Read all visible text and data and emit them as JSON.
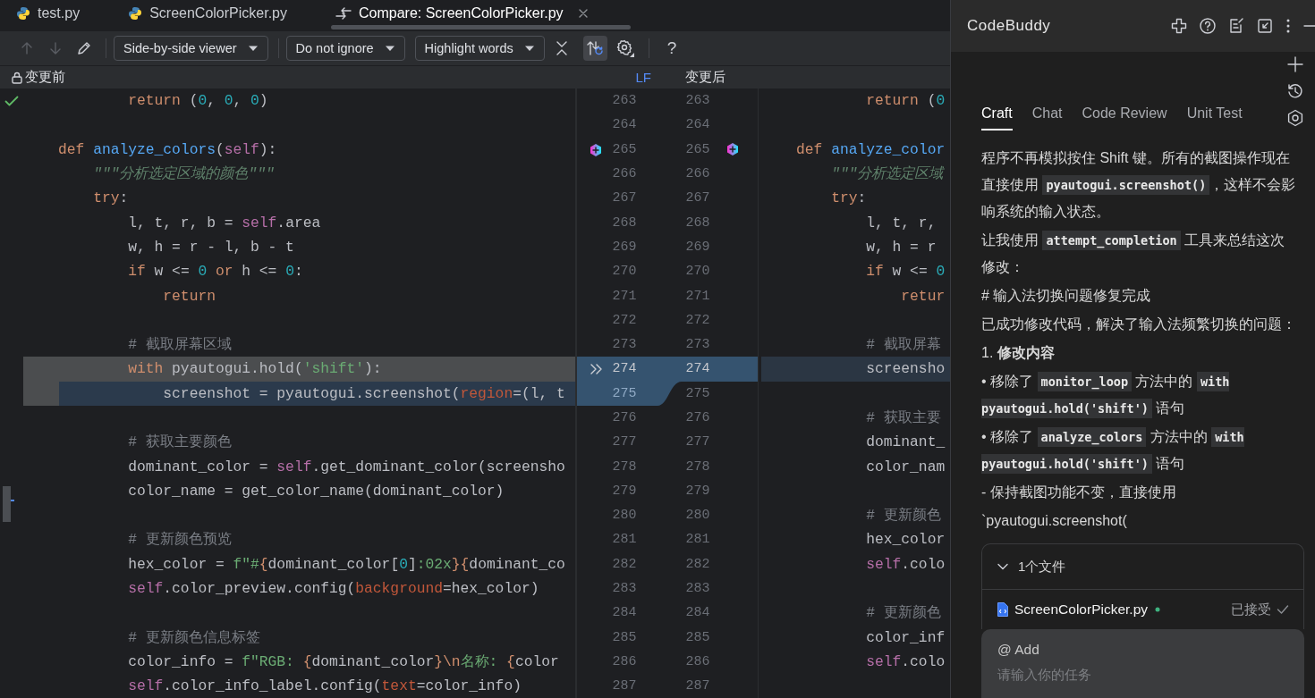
{
  "editor_tabs": [
    {
      "kind": "python",
      "label": "test.py",
      "selected": false
    },
    {
      "kind": "python",
      "label": "ScreenColorPicker.py",
      "selected": false
    },
    {
      "kind": "compare",
      "label": "Compare: ScreenColorPicker.py",
      "selected": true
    }
  ],
  "toolbar": [
    {
      "kind": "up",
      "disabled": true
    },
    {
      "kind": "down",
      "disabled": true
    },
    {
      "kind": "edit",
      "disabled": false
    },
    {
      "kind": "separator"
    },
    {
      "kind": "dropdown",
      "label": "Side-by-side viewer"
    },
    {
      "kind": "separator"
    },
    {
      "kind": "dropdown",
      "label": "Do not ignore"
    },
    {
      "kind": "dropdown",
      "label": "Highlight words"
    },
    {
      "kind": "collapse"
    },
    {
      "kind": "sync",
      "selected": true
    },
    {
      "kind": "settings"
    },
    {
      "kind": "separator"
    },
    {
      "kind": "help",
      "label": "?"
    }
  ],
  "diff_header": {
    "left_label": "变更前",
    "line_separator": "LF",
    "right_label": "变更后"
  },
  "left_pane": {
    "lines": [
      {
        "number": "263",
        "kind": "context",
        "inspection_ok": true,
        "tokens": [
          {
            "kind": "keyword",
            "text": "            return"
          },
          {
            "kind": "plain",
            "text": " ("
          },
          {
            "kind": "number",
            "text": "0"
          },
          {
            "kind": "plain",
            "text": ", "
          },
          {
            "kind": "number",
            "text": "0"
          },
          {
            "kind": "plain",
            "text": ", "
          },
          {
            "kind": "number",
            "text": "0"
          },
          {
            "kind": "plain",
            "text": ")"
          }
        ]
      },
      {
        "number": "264",
        "kind": "context"
      },
      {
        "number": "265",
        "kind": "context",
        "ai_action": true,
        "tokens": [
          {
            "kind": "keyword",
            "text": "    def"
          },
          {
            "kind": "func",
            "text": " analyze_colors"
          },
          {
            "kind": "plain",
            "text": "("
          },
          {
            "kind": "self",
            "text": "self"
          },
          {
            "kind": "plain",
            "text": "):"
          }
        ]
      },
      {
        "number": "266",
        "kind": "context",
        "tokens": [
          {
            "kind": "doc",
            "text": "        \"\"\"分析选定区域的颜色\"\"\""
          }
        ]
      },
      {
        "number": "267",
        "kind": "context",
        "tokens": [
          {
            "kind": "keyword",
            "text": "        try"
          },
          {
            "kind": "plain",
            "text": ":"
          }
        ]
      },
      {
        "number": "268",
        "kind": "context",
        "tokens": [
          {
            "kind": "plain",
            "text": "            l, t, r, b = "
          },
          {
            "kind": "self",
            "text": "self"
          },
          {
            "kind": "plain",
            "text": ".area"
          }
        ]
      },
      {
        "number": "269",
        "kind": "context",
        "tokens": [
          {
            "kind": "plain",
            "text": "            w, h = r - l, b - t"
          }
        ]
      },
      {
        "number": "270",
        "kind": "context",
        "tokens": [
          {
            "kind": "keyword",
            "text": "            if"
          },
          {
            "kind": "plain",
            "text": " w <= "
          },
          {
            "kind": "number",
            "text": "0"
          },
          {
            "kind": "keyword",
            "text": " or"
          },
          {
            "kind": "plain",
            "text": " h <= "
          },
          {
            "kind": "number",
            "text": "0"
          },
          {
            "kind": "plain",
            "text": ":"
          }
        ]
      },
      {
        "number": "271",
        "kind": "context",
        "tokens": [
          {
            "kind": "keyword",
            "text": "                return"
          }
        ]
      },
      {
        "number": "272",
        "kind": "context"
      },
      {
        "number": "273",
        "kind": "context",
        "tokens": [
          {
            "kind": "comment",
            "text": "            # 截取屏幕区域"
          }
        ]
      },
      {
        "number": "274",
        "kind": "deleted",
        "apply_arrow": true,
        "tokens": [
          {
            "kind": "keyword",
            "text": "            with"
          },
          {
            "kind": "plain",
            "text": " pyautogui.hold("
          },
          {
            "kind": "string",
            "text": "'shift'"
          },
          {
            "kind": "plain",
            "text": "):"
          }
        ]
      },
      {
        "number": "275",
        "kind": "mixed",
        "tokens": [
          {
            "kind": "plain",
            "text": "                screenshot = pyautogui.screenshot("
          },
          {
            "kind": "param",
            "text": "region"
          },
          {
            "kind": "plain",
            "text": "=(l, t"
          }
        ]
      },
      {
        "number": "276",
        "kind": "context"
      },
      {
        "number": "277",
        "kind": "context",
        "tokens": [
          {
            "kind": "comment",
            "text": "            # 获取主要颜色"
          }
        ]
      },
      {
        "number": "278",
        "kind": "context",
        "tokens": [
          {
            "kind": "plain",
            "text": "            dominant_color = "
          },
          {
            "kind": "self",
            "text": "self"
          },
          {
            "kind": "plain",
            "text": ".get_dominant_color(screensho"
          }
        ]
      },
      {
        "number": "279",
        "kind": "context",
        "bookmarked": true,
        "tokens": [
          {
            "kind": "plain",
            "text": "            color_name = get_color_name(dominant_color)"
          }
        ]
      },
      {
        "number": "280",
        "kind": "context"
      },
      {
        "number": "281",
        "kind": "context",
        "tokens": [
          {
            "kind": "comment",
            "text": "            # 更新颜色预览"
          }
        ]
      },
      {
        "number": "282",
        "kind": "context",
        "tokens": [
          {
            "kind": "plain",
            "text": "            hex_color = "
          },
          {
            "kind": "string",
            "text": "f\"#"
          },
          {
            "kind": "keyword",
            "text": "{"
          },
          {
            "kind": "plain",
            "text": "dominant_color["
          },
          {
            "kind": "number",
            "text": "0"
          },
          {
            "kind": "plain",
            "text": "]"
          },
          {
            "kind": "string",
            "text": ":02x"
          },
          {
            "kind": "keyword",
            "text": "}{"
          },
          {
            "kind": "plain",
            "text": "dominant_co"
          }
        ]
      },
      {
        "number": "283",
        "kind": "context",
        "tokens": [
          {
            "kind": "self",
            "text": "            self"
          },
          {
            "kind": "plain",
            "text": ".color_preview.config("
          },
          {
            "kind": "param",
            "text": "background"
          },
          {
            "kind": "plain",
            "text": "=hex_color)"
          }
        ]
      },
      {
        "number": "284",
        "kind": "context"
      },
      {
        "number": "285",
        "kind": "context",
        "tokens": [
          {
            "kind": "comment",
            "text": "            # 更新颜色信息标签"
          }
        ]
      },
      {
        "number": "286",
        "kind": "context",
        "tokens": [
          {
            "kind": "plain",
            "text": "            color_info = "
          },
          {
            "kind": "string",
            "text": "f\"RGB: "
          },
          {
            "kind": "keyword",
            "text": "{"
          },
          {
            "kind": "plain",
            "text": "dominant_color"
          },
          {
            "kind": "keyword",
            "text": "}\\n"
          },
          {
            "kind": "string",
            "text": "名称: "
          },
          {
            "kind": "keyword",
            "text": "{"
          },
          {
            "kind": "plain",
            "text": "color"
          }
        ]
      },
      {
        "number": "287",
        "kind": "context",
        "tokens": [
          {
            "kind": "self",
            "text": "            self"
          },
          {
            "kind": "plain",
            "text": ".color_info_label.config("
          },
          {
            "kind": "param",
            "text": "text"
          },
          {
            "kind": "plain",
            "text": "=color_info)"
          }
        ]
      }
    ]
  },
  "right_pane": {
    "lines": [
      {
        "number": "263",
        "kind": "context",
        "tokens": [
          {
            "kind": "keyword",
            "text": "            return"
          },
          {
            "kind": "plain",
            "text": " ("
          },
          {
            "kind": "number",
            "text": "0"
          }
        ]
      },
      {
        "number": "264",
        "kind": "context"
      },
      {
        "number": "265",
        "kind": "context",
        "ai_action": true,
        "tokens": [
          {
            "kind": "keyword",
            "text": "    def"
          },
          {
            "kind": "func",
            "text": " analyze_color"
          }
        ]
      },
      {
        "number": "266",
        "kind": "context",
        "tokens": [
          {
            "kind": "doc",
            "text": "        \"\"\"分析选定区域"
          }
        ]
      },
      {
        "number": "267",
        "kind": "context",
        "tokens": [
          {
            "kind": "keyword",
            "text": "        try"
          },
          {
            "kind": "plain",
            "text": ":"
          }
        ]
      },
      {
        "number": "268",
        "kind": "context",
        "tokens": [
          {
            "kind": "plain",
            "text": "            l, t, r,"
          }
        ]
      },
      {
        "number": "269",
        "kind": "context",
        "tokens": [
          {
            "kind": "plain",
            "text": "            w, h = r"
          }
        ]
      },
      {
        "number": "270",
        "kind": "context",
        "tokens": [
          {
            "kind": "keyword",
            "text": "            if"
          },
          {
            "kind": "plain",
            "text": " w <= "
          },
          {
            "kind": "number",
            "text": "0"
          }
        ]
      },
      {
        "number": "271",
        "kind": "context",
        "tokens": [
          {
            "kind": "keyword",
            "text": "                retur"
          }
        ]
      },
      {
        "number": "272",
        "kind": "context"
      },
      {
        "number": "273",
        "kind": "context",
        "tokens": [
          {
            "kind": "comment",
            "text": "            # 截取屏幕"
          }
        ]
      },
      {
        "number": "274",
        "kind": "modified",
        "tokens": [
          {
            "kind": "plain",
            "text": "            screensho"
          }
        ]
      },
      {
        "number": "275",
        "kind": "context"
      },
      {
        "number": "276",
        "kind": "context",
        "tokens": [
          {
            "kind": "comment",
            "text": "            # 获取主要"
          }
        ]
      },
      {
        "number": "277",
        "kind": "context",
        "tokens": [
          {
            "kind": "plain",
            "text": "            dominant_"
          }
        ]
      },
      {
        "number": "278",
        "kind": "context",
        "tokens": [
          {
            "kind": "plain",
            "text": "            color_nam"
          }
        ]
      },
      {
        "number": "279",
        "kind": "context"
      },
      {
        "number": "280",
        "kind": "context",
        "tokens": [
          {
            "kind": "comment",
            "text": "            # 更新颜色"
          }
        ]
      },
      {
        "number": "281",
        "kind": "context",
        "tokens": [
          {
            "kind": "plain",
            "text": "            hex_color"
          }
        ]
      },
      {
        "number": "282",
        "kind": "context",
        "tokens": [
          {
            "kind": "self",
            "text": "            self"
          },
          {
            "kind": "plain",
            "text": ".colo"
          }
        ]
      },
      {
        "number": "283",
        "kind": "context"
      },
      {
        "number": "284",
        "kind": "context",
        "tokens": [
          {
            "kind": "comment",
            "text": "            # 更新颜色"
          }
        ]
      },
      {
        "number": "285",
        "kind": "context",
        "tokens": [
          {
            "kind": "plain",
            "text": "            color_inf"
          }
        ]
      },
      {
        "number": "286",
        "kind": "context",
        "tokens": [
          {
            "kind": "self",
            "text": "            self"
          },
          {
            "kind": "plain",
            "text": ".colo"
          }
        ]
      },
      {
        "number": "287",
        "kind": "context"
      }
    ]
  },
  "chat": {
    "title": "CodeBuddy",
    "tabs": [
      {
        "label": "Craft",
        "selected": true
      },
      {
        "label": "Chat",
        "selected": false
      },
      {
        "label": "Code Review",
        "selected": false
      },
      {
        "label": "Unit Test",
        "selected": false
      }
    ],
    "messages": [
      {
        "segments": [
          {
            "kind": "text",
            "text": "程序不再模拟按住 Shift 键。所有的截图操作现在直接使用 "
          },
          {
            "kind": "code",
            "text": "pyautogui.screenshot()"
          },
          {
            "kind": "text",
            "text": "，这样不会影响系统的输入状态。"
          }
        ]
      },
      {
        "segments": [
          {
            "kind": "text",
            "text": "让我使用 "
          },
          {
            "kind": "code",
            "text": "attempt_completion"
          },
          {
            "kind": "text",
            "text": " 工具来总结这次修改："
          }
        ]
      },
      {
        "segments": [
          {
            "kind": "text",
            "text": "# 输入法切换问题修复完成"
          }
        ]
      },
      {
        "segments": [
          {
            "kind": "text",
            "text": "已成功修改代码，解决了输入法频繁切换的问题："
          }
        ]
      },
      {
        "segments": [
          {
            "kind": "text",
            "text": "1. **修改内容**"
          }
        ]
      },
      {
        "segments": [
          {
            "kind": "text",
            "text": "•   移除了 "
          },
          {
            "kind": "code",
            "text": "monitor_loop"
          },
          {
            "kind": "text",
            "text": " 方法中的 "
          },
          {
            "kind": "code",
            "text": "with pyautogui.hold('shift')"
          },
          {
            "kind": "text",
            "text": " 语句"
          }
        ]
      },
      {
        "segments": [
          {
            "kind": "text",
            "text": "•   移除了 "
          },
          {
            "kind": "code",
            "text": "analyze_colors"
          },
          {
            "kind": "text",
            "text": " 方法中的 "
          },
          {
            "kind": "code",
            "text": "with pyautogui.hold('shift')"
          },
          {
            "kind": "text",
            "text": " 语句"
          }
        ]
      },
      {
        "segments": [
          {
            "kind": "text",
            "text": "- 保持截图功能不变，直接使用"
          }
        ]
      },
      {
        "segments": [
          {
            "kind": "text",
            "text": "`pyautogui.screenshot("
          }
        ]
      }
    ],
    "files": {
      "summary": "1个文件",
      "expanded": true,
      "items": [
        {
          "name": "ScreenColorPicker.py",
          "status": "已接受"
        }
      ]
    },
    "input": {
      "mention": "@ Add",
      "placeholder": "请输入你的任务"
    }
  }
}
